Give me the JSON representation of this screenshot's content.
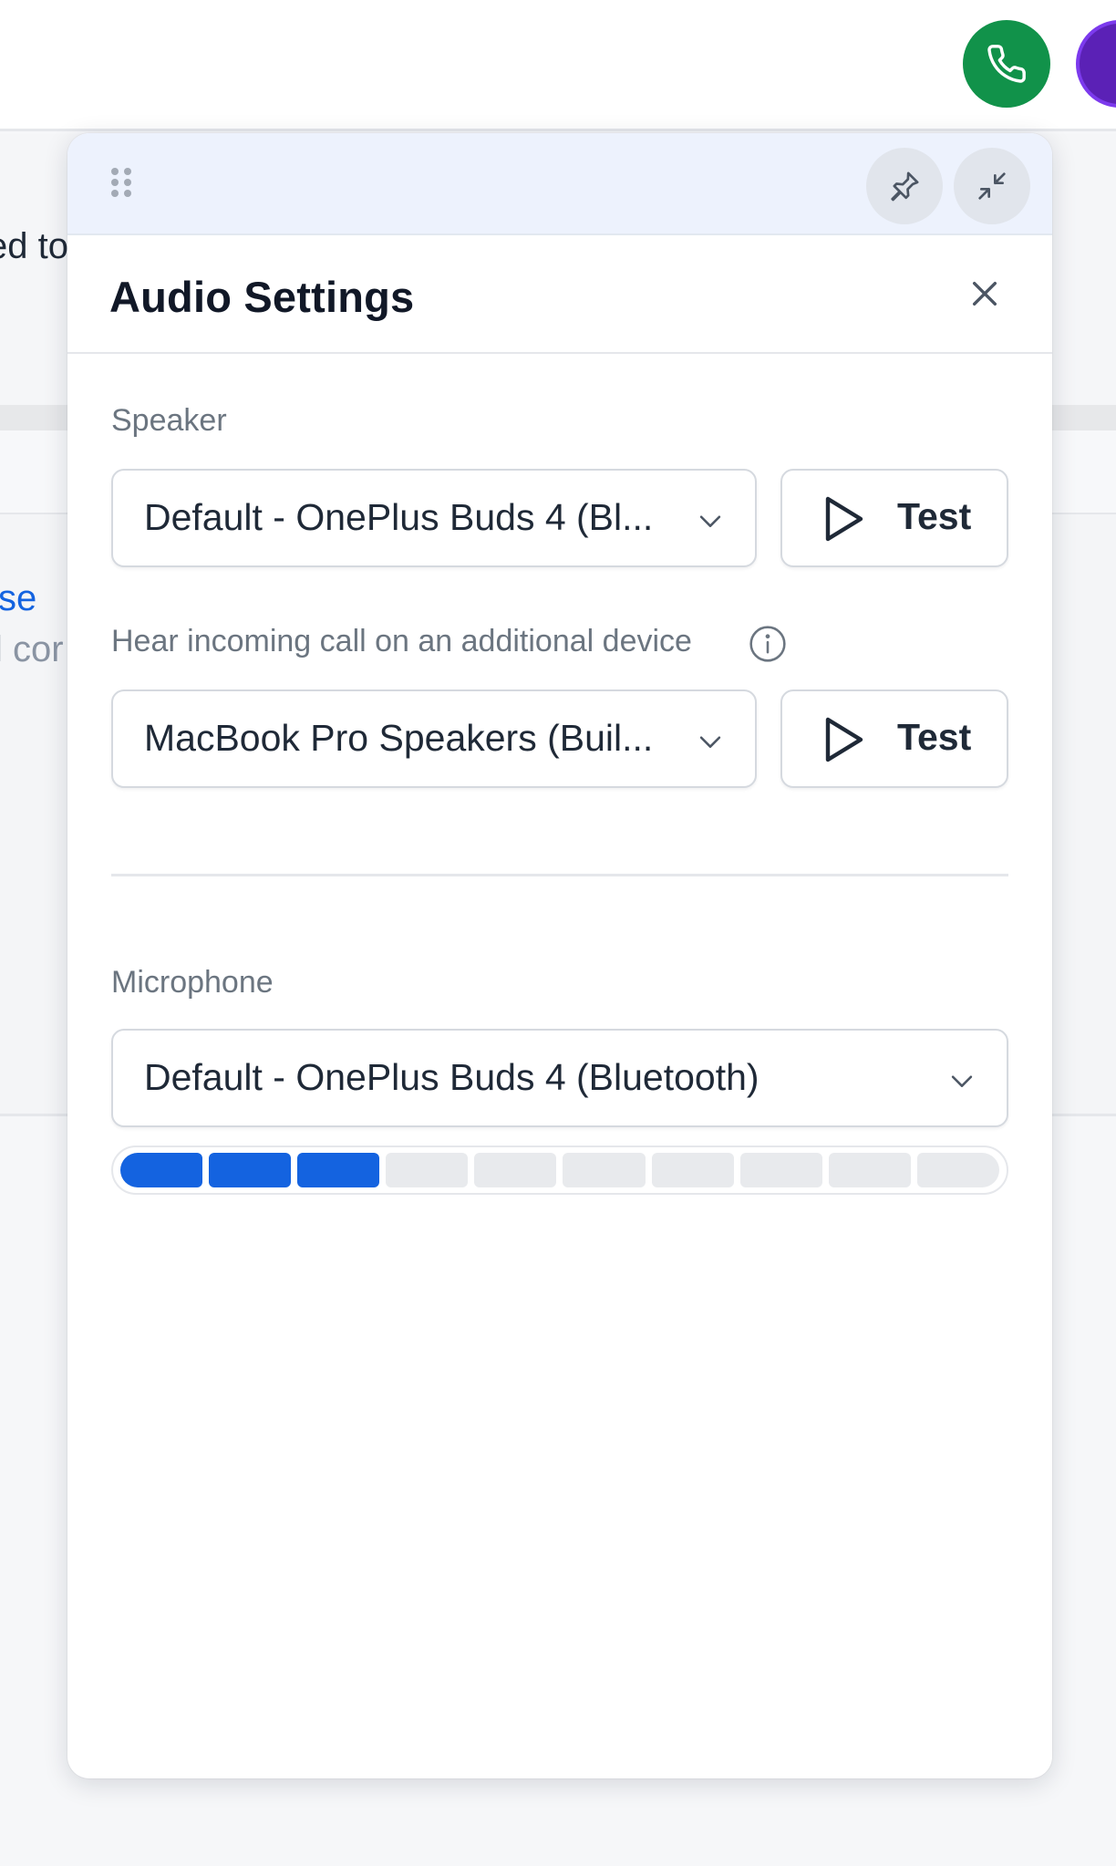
{
  "background": {
    "partial_text_1": "ed to",
    "partial_text_2": "se",
    "partial_text_3": "l cor",
    "call_button_icon": "phone-icon",
    "call_button_color": "#11924a",
    "avatar_color": "#5b21b6"
  },
  "modal": {
    "title": "Audio Settings",
    "toolbar": {
      "drag_icon": "drag-handle-icon",
      "pin_icon": "pin-icon",
      "minimize_icon": "minimize-icon"
    },
    "close_icon": "close-icon",
    "speaker": {
      "label": "Speaker",
      "selected": "Default - OnePlus Buds 4 (Bl...",
      "test_label": "Test"
    },
    "additional_device": {
      "label": "Hear incoming call on an additional device",
      "info_icon": "info-icon",
      "selected": "MacBook Pro Speakers (Buil...",
      "test_label": "Test"
    },
    "microphone": {
      "label": "Microphone",
      "selected": "Default - OnePlus Buds 4 (Bluetooth)",
      "level": {
        "active_segments": 3,
        "total_segments": 10
      }
    },
    "accent_color": "#1463e0"
  }
}
